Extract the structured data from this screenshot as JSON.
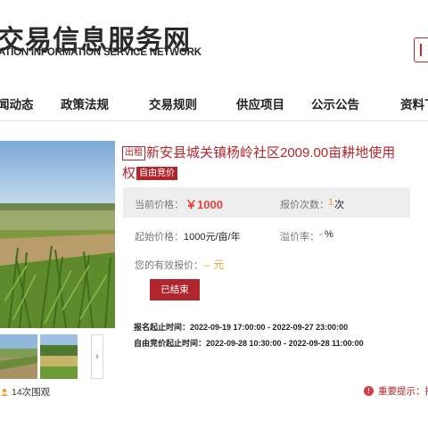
{
  "header": {
    "title": "交易信息服务网",
    "subtitle": "ATION INFORMATION SERVICE NETWORK"
  },
  "nav": {
    "items": [
      {
        "label": "闻动态"
      },
      {
        "label": "政策法规"
      },
      {
        "label": "交易规则"
      },
      {
        "label": "供应项目"
      },
      {
        "label": "公示公告"
      },
      {
        "label": "资料下"
      }
    ]
  },
  "listing": {
    "type_tag": "出租",
    "title_line1": "新安县城关镇杨岭社区2009.00亩耕地使用",
    "title_line2": "权",
    "mode_tag": "自由竞价",
    "current_price_label": "当前价格：",
    "current_price_value": "￥1000",
    "bid_count_label": "报价次数：",
    "bid_count_value": "1",
    "bid_count_unit": "次",
    "start_price_label": "起始价格：",
    "start_price_value": "1000元/亩/年",
    "premium_label": "溢价率：",
    "premium_value": "-",
    "premium_unit": "%",
    "my_bid_label": "您的有效报价：",
    "my_bid_value": "-- 元",
    "status_button": "已结束",
    "signup_time": "报名起止时间：2022-09-19 17:00:00 - 2022-09-27 23:00:00",
    "bidding_time": "自由竞价起止时间：2022-09-28 10:30:00 - 2022-09-28 11:00:00"
  },
  "gallery": {
    "next_arrow": "›",
    "views_text": "14次围观"
  },
  "notice": {
    "icon": "!",
    "text": "重要提示：接"
  },
  "colors": {
    "brand": "#b0262c",
    "price": "#e8403f",
    "accent_orange": "#f0a030"
  }
}
